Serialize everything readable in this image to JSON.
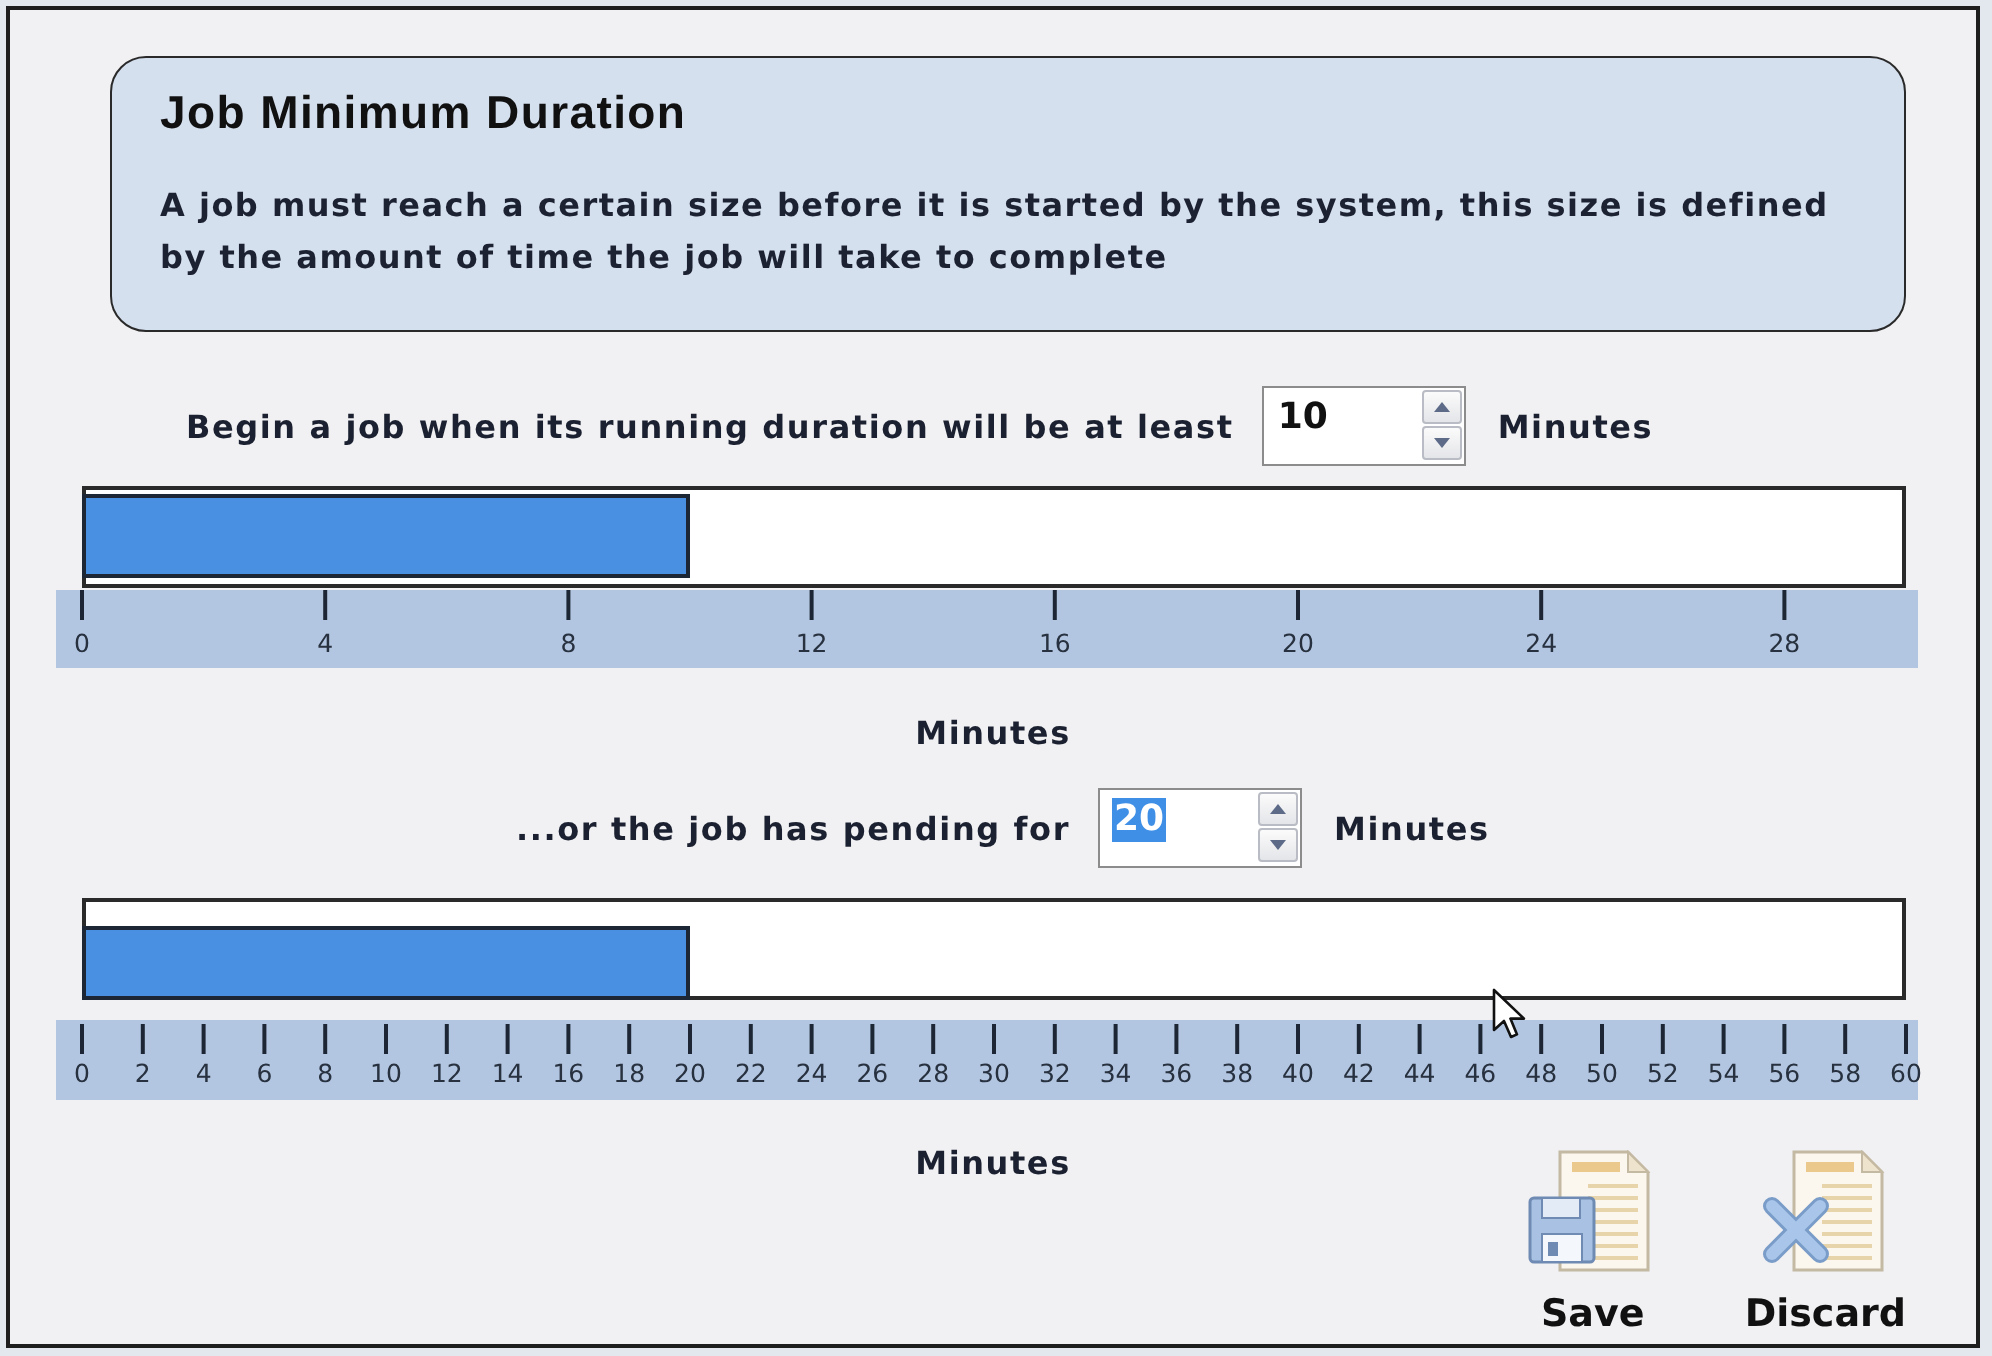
{
  "info": {
    "title": "Job Minimum Duration",
    "description": "A job must reach a certain size before it is started by the system, this size is defined by the amount of time the job will take to complete"
  },
  "thresholds": [
    {
      "prompt": "Begin a job when its running duration will be at least",
      "value": "10",
      "highlighted": false,
      "unit": "Minutes",
      "level": 0.3333,
      "scale": [
        "0",
        "4",
        "8",
        "12",
        "16",
        "20",
        "24",
        "28"
      ],
      "scale_title": "Minutes"
    },
    {
      "prompt": "...or the job has pending for",
      "value": "20",
      "highlighted": true,
      "unit": "Minutes",
      "level": 0.3333,
      "scale": [
        "0",
        "2",
        "4",
        "6",
        "8",
        "10",
        "12",
        "14",
        "16",
        "18",
        "20",
        "22",
        "24",
        "26",
        "28",
        "30",
        "32",
        "34",
        "36",
        "38",
        "40",
        "42",
        "44",
        "46",
        "48",
        "50",
        "52",
        "54",
        "56",
        "58",
        "60"
      ],
      "scale_title": "Minutes"
    }
  ],
  "buttons": [
    {
      "label": "Save",
      "kind": "save"
    },
    {
      "label": "Discard",
      "kind": "discard"
    }
  ]
}
